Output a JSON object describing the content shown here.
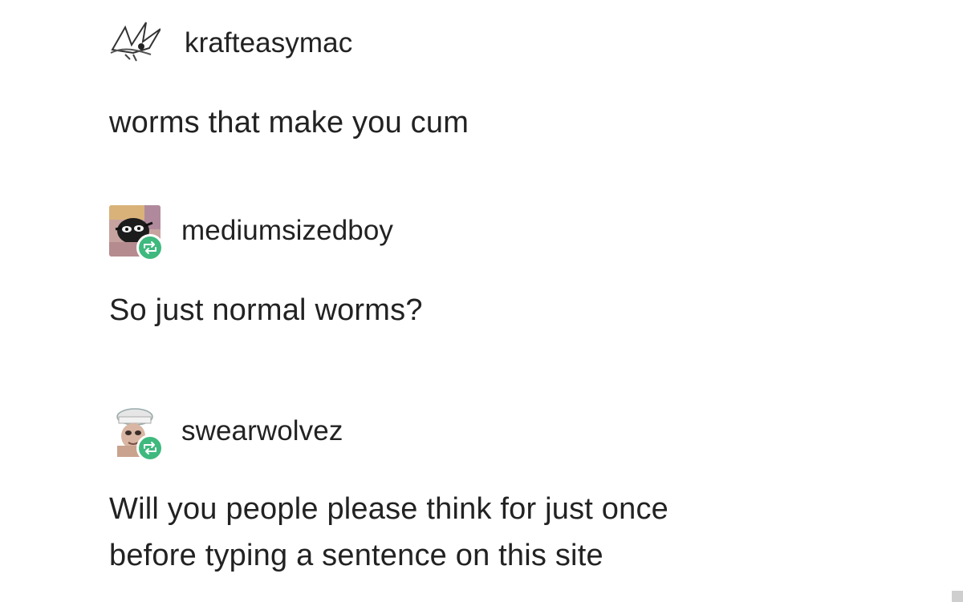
{
  "posts": [
    {
      "username": "krafteasymac",
      "text": "worms that make you cum",
      "avatar_icon": "bird-sketch-icon",
      "reblog": false
    },
    {
      "username": "mediumsizedboy",
      "text": "So just normal worms?",
      "avatar_icon": "creature-avatar-icon",
      "reblog": true
    },
    {
      "username": "swearwolvez",
      "text_lines": [
        "Will you people please think for just once",
        "before typing a sentence on this site"
      ],
      "avatar_icon": "character-avatar-icon",
      "reblog": true
    }
  ],
  "colors": {
    "reblog_badge": "#3fb97e",
    "text": "#222222",
    "background": "#ffffff"
  }
}
